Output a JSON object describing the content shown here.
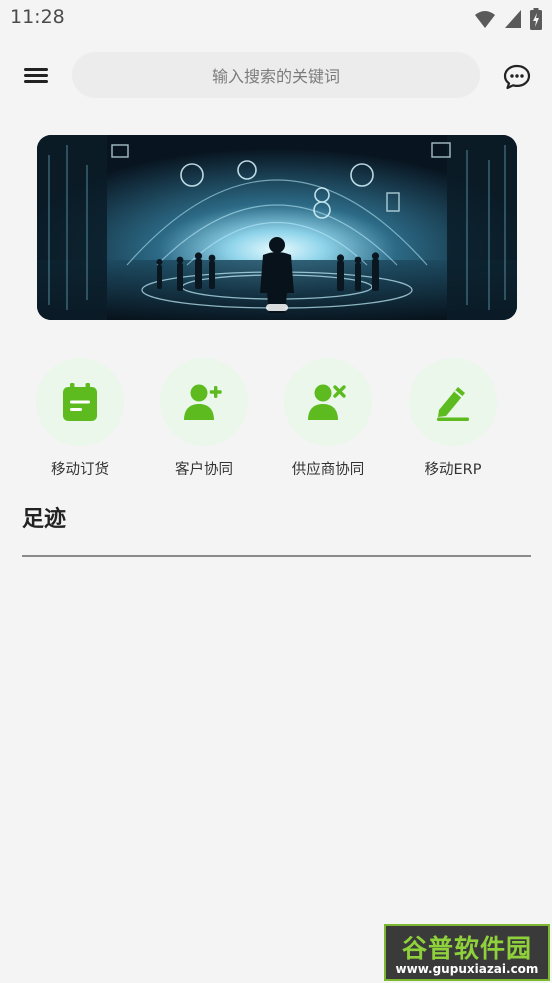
{
  "status_bar": {
    "time": "11:28"
  },
  "header": {
    "search_placeholder": "输入搜索的关键词",
    "menu_icon": "hamburger-icon",
    "message_icon": "chat-bubble-icon"
  },
  "banner": {
    "image": "futuristic-digital-city-illustration"
  },
  "shortcuts": [
    {
      "label": "移动订货",
      "icon": "calendar-icon"
    },
    {
      "label": "客户协同",
      "icon": "user-add-icon"
    },
    {
      "label": "供应商协同",
      "icon": "user-remove-icon"
    },
    {
      "label": "移动ERP",
      "icon": "edit-pen-icon"
    }
  ],
  "section": {
    "title": "足迹"
  },
  "watermark": {
    "title": "谷普软件园",
    "url": "www.gupuxiazai.com"
  },
  "colors": {
    "accent": "#5dbb1f",
    "icon_bg": "#eaf7ea",
    "page_bg": "#f4f4f4"
  }
}
